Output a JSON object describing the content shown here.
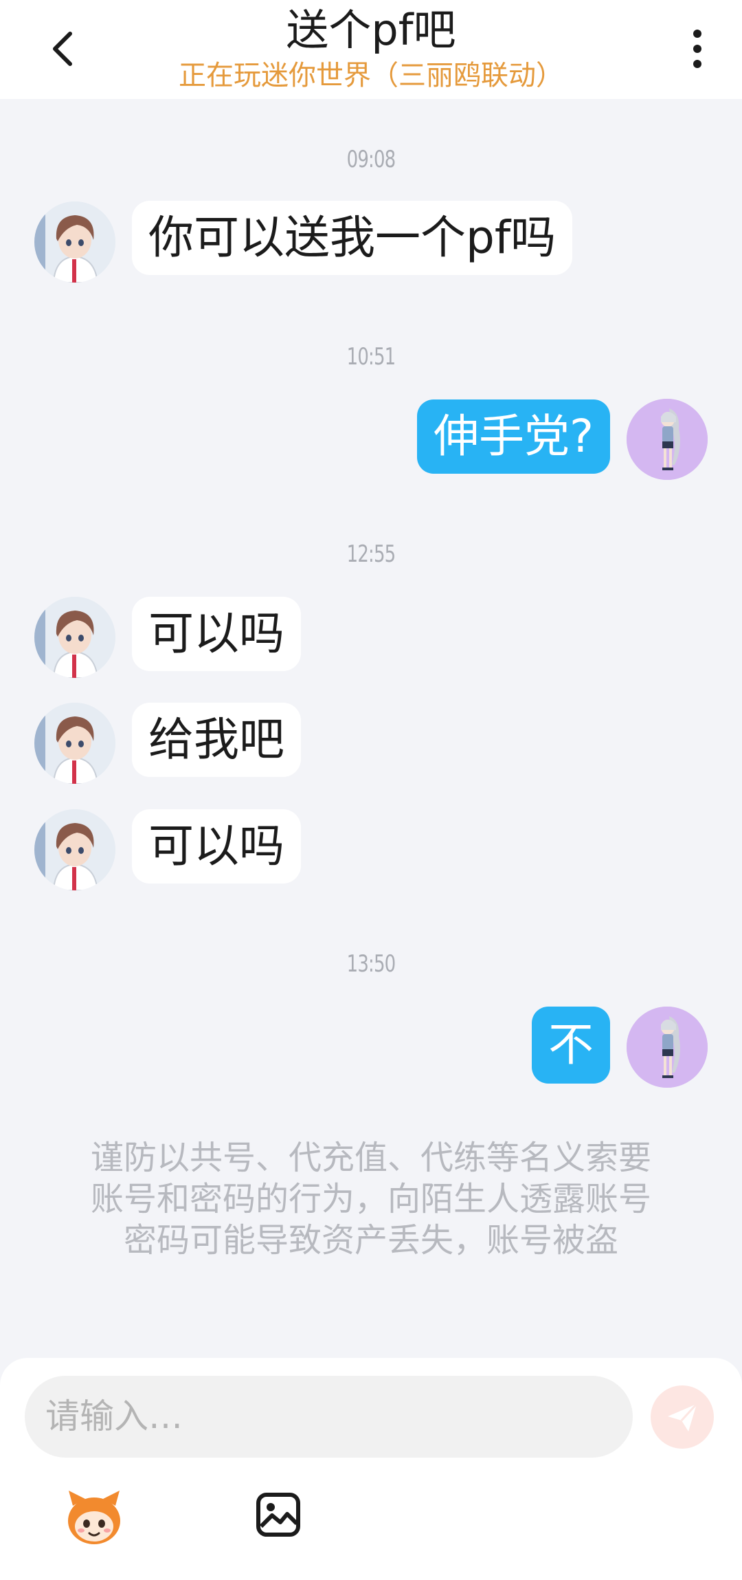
{
  "header": {
    "title": "送个pf吧",
    "subtitle": "正在玩迷你世界（三丽鸥联动）"
  },
  "messages": [
    {
      "time": "09:08"
    },
    {
      "text": "你可以送我一个pf吗"
    },
    {
      "time": "10:51"
    },
    {
      "text": "伸手党?"
    },
    {
      "time": "12:55"
    },
    {
      "text": "可以吗"
    },
    {
      "text": "给我吧"
    },
    {
      "text": "可以吗"
    },
    {
      "time": "13:50"
    },
    {
      "text": "不"
    }
  ],
  "warning": {
    "line1": "谨防以共号、代充值、代练等名义索要",
    "line2": "账号和密码的行为，向陌生人透露账号",
    "line3": "密码可能导致资产丢失，账号被盗"
  },
  "composer": {
    "placeholder": "请输入…",
    "send_icon": "send-icon",
    "emoji_icon": "mascot-emoji-icon",
    "image_icon": "image-icon"
  },
  "colors": {
    "accent": "#28b3f4",
    "subtitle": "#e59a3c",
    "background": "#f3f4f8"
  }
}
